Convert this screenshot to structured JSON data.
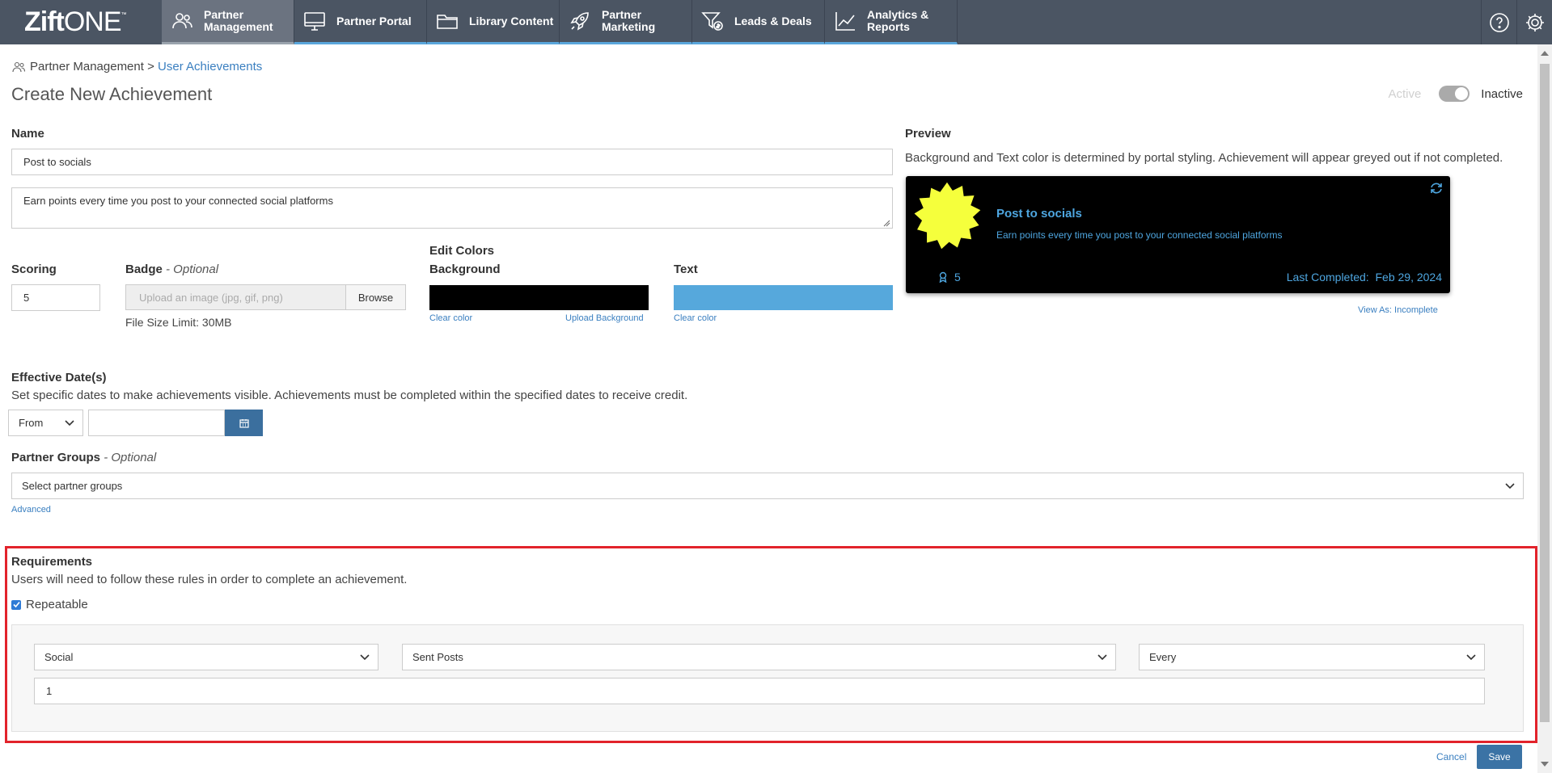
{
  "logo": {
    "bold": "Zift",
    "thin": "ONE",
    "tm": "™"
  },
  "nav": {
    "tabs": [
      {
        "label": "Partner Management",
        "icon": "users-icon"
      },
      {
        "label": "Partner Portal",
        "icon": "monitor-icon"
      },
      {
        "label": "Library Content",
        "icon": "folder-icon"
      },
      {
        "label": "Partner Marketing",
        "icon": "rocket-icon"
      },
      {
        "label": "Leads & Deals",
        "icon": "funnel-dollar-icon"
      },
      {
        "label": "Analytics & Reports",
        "icon": "line-chart-icon"
      }
    ],
    "active_tab": "Partner Management"
  },
  "breadcrumb": {
    "parent": "Partner Management",
    "separator": ">",
    "current": "User Achievements"
  },
  "page_title": "Create New Achievement",
  "status": {
    "active_label": "Active",
    "inactive_label": "Inactive",
    "is_active": false
  },
  "form": {
    "name_label": "Name",
    "name_value": "Post to socials",
    "description_value": "Earn points every time you post to your connected social platforms",
    "scoring_label": "Scoring",
    "scoring_value": "5",
    "badge_label": "Badge",
    "badge_optional": "- Optional",
    "badge_placeholder": "Upload an image (jpg, gif, png)",
    "browse_label": "Browse",
    "file_size_limit": "File Size Limit: 30MB",
    "edit_colors_label": "Edit Colors",
    "background_label": "Background",
    "background_color": "#000000",
    "clear_color_label": "Clear color",
    "upload_background_label": "Upload Background",
    "text_label": "Text",
    "text_color": "#56a8dc",
    "effective_dates_label": "Effective Date(s)",
    "effective_dates_desc": "Set specific dates to make achievements visible. Achievements must be completed within the specified dates to receive credit.",
    "date_mode": "From",
    "date_value": "",
    "partner_groups_label": "Partner Groups",
    "partner_groups_optional": "- Optional",
    "partner_groups_placeholder": "Select partner groups",
    "advanced_label": "Advanced"
  },
  "preview": {
    "label": "Preview",
    "desc": "Background and Text color is determined by portal styling. Achievement will appear greyed out if not completed.",
    "title": "Post to socials",
    "description": "Earn points every time you post to your connected social platforms",
    "score": "5",
    "last_completed_label": "Last Completed:",
    "last_completed_date": "Feb 29, 2024",
    "view_as_label": "View As: Incomplete",
    "badge_color": "#f5ff3c"
  },
  "requirements": {
    "label": "Requirements",
    "desc": "Users will need to follow these rules in order to complete an achievement.",
    "repeatable_label": "Repeatable",
    "repeatable_checked": true,
    "rule": {
      "category": "Social",
      "action": "Sent Posts",
      "frequency": "Every",
      "count": "1"
    }
  },
  "actions": {
    "cancel_label": "Cancel",
    "save_label": "Save"
  }
}
